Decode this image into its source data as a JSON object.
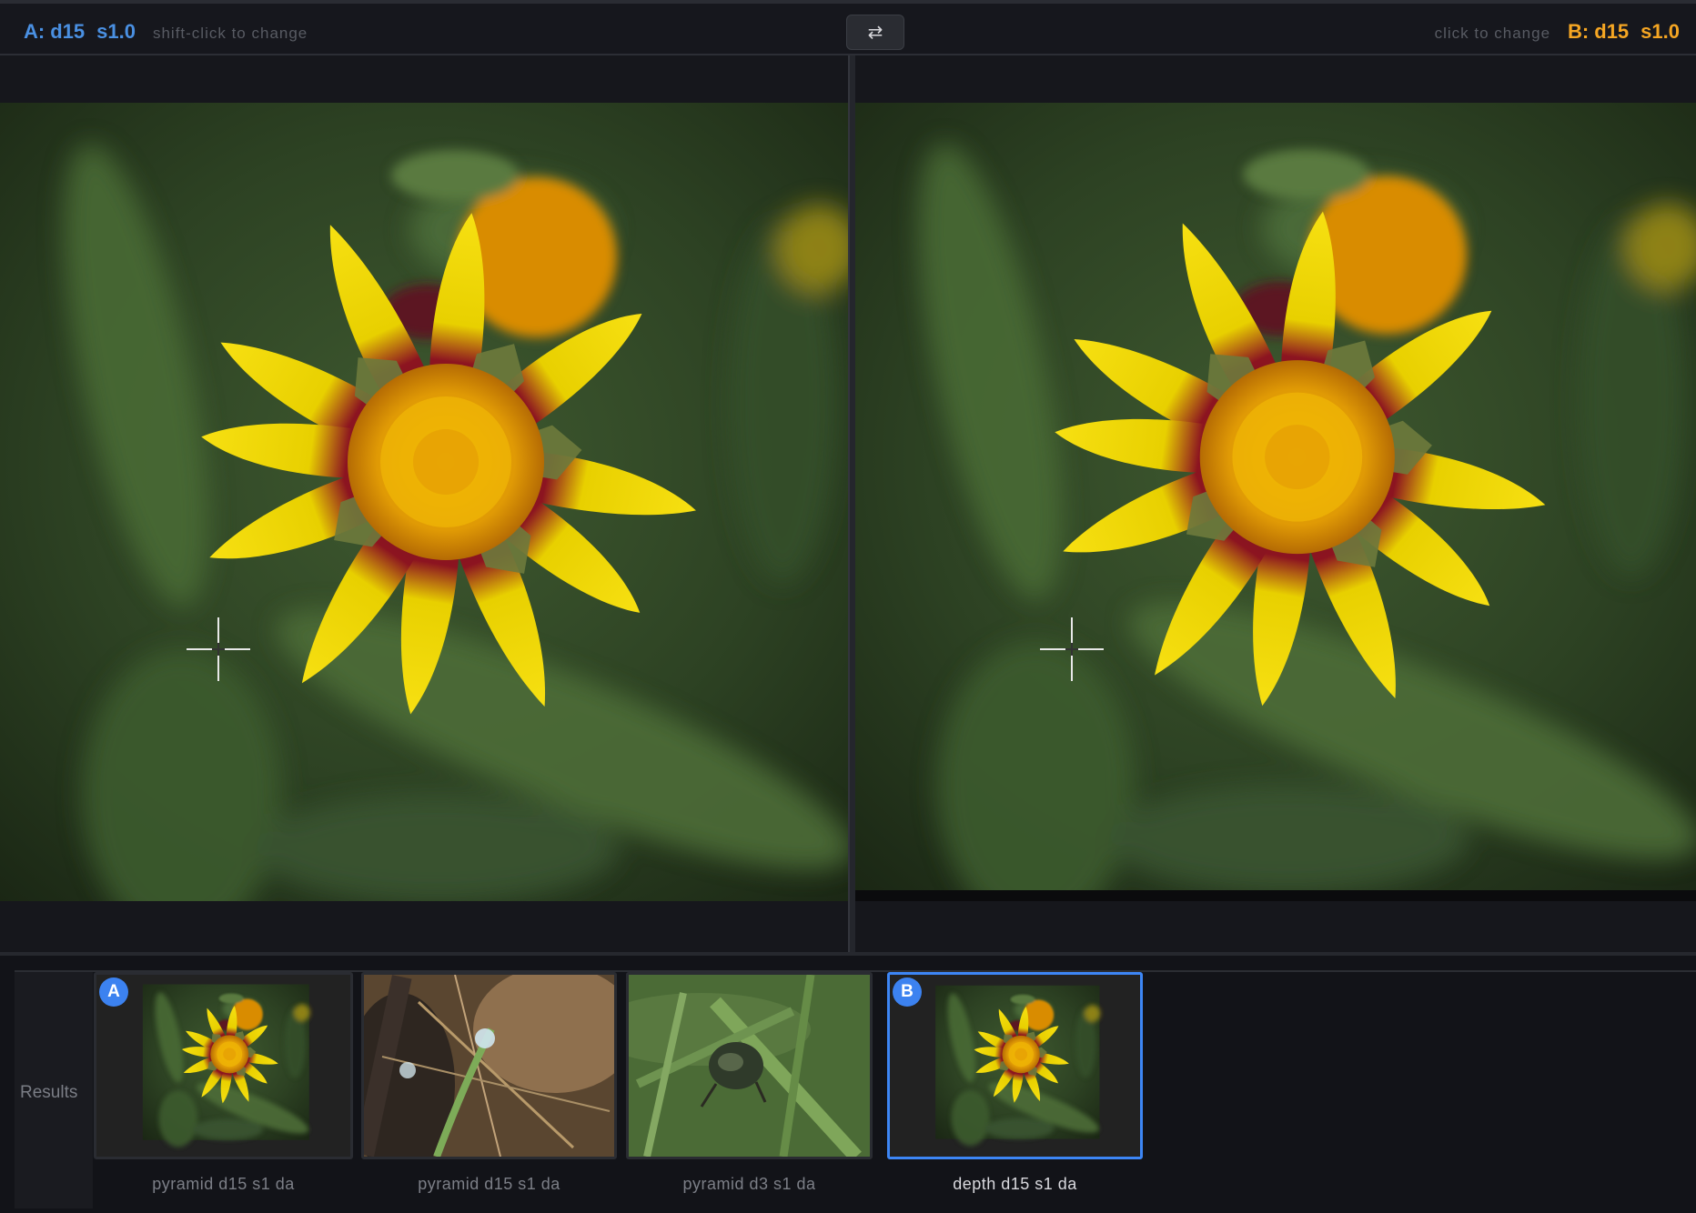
{
  "compare": {
    "a": {
      "prefix": "A:",
      "depth": "d15",
      "scale": "s1.0",
      "hint": "shift-click to change"
    },
    "b": {
      "prefix": "B:",
      "depth": "d15",
      "scale": "s1.0",
      "hint": "click to change"
    },
    "swap_icon": "⇄"
  },
  "colors": {
    "a_accent": "#4a90e2",
    "b_accent": "#f5a623",
    "selected_border": "#3d86f5"
  },
  "viewer": {
    "cursor_icon": "crosshair-icon"
  },
  "results": {
    "label": "Results",
    "items": [
      {
        "caption": "pyramid d15 s1 da",
        "badge": "A",
        "image": "flower"
      },
      {
        "caption": "pyramid d15 s1 da",
        "badge": "",
        "image": "water-droplet-twig"
      },
      {
        "caption": "pyramid d3 s1 da",
        "badge": "",
        "image": "beetle-on-grass"
      },
      {
        "caption": "depth d15 s1 da",
        "badge": "B",
        "image": "flower"
      }
    ]
  }
}
